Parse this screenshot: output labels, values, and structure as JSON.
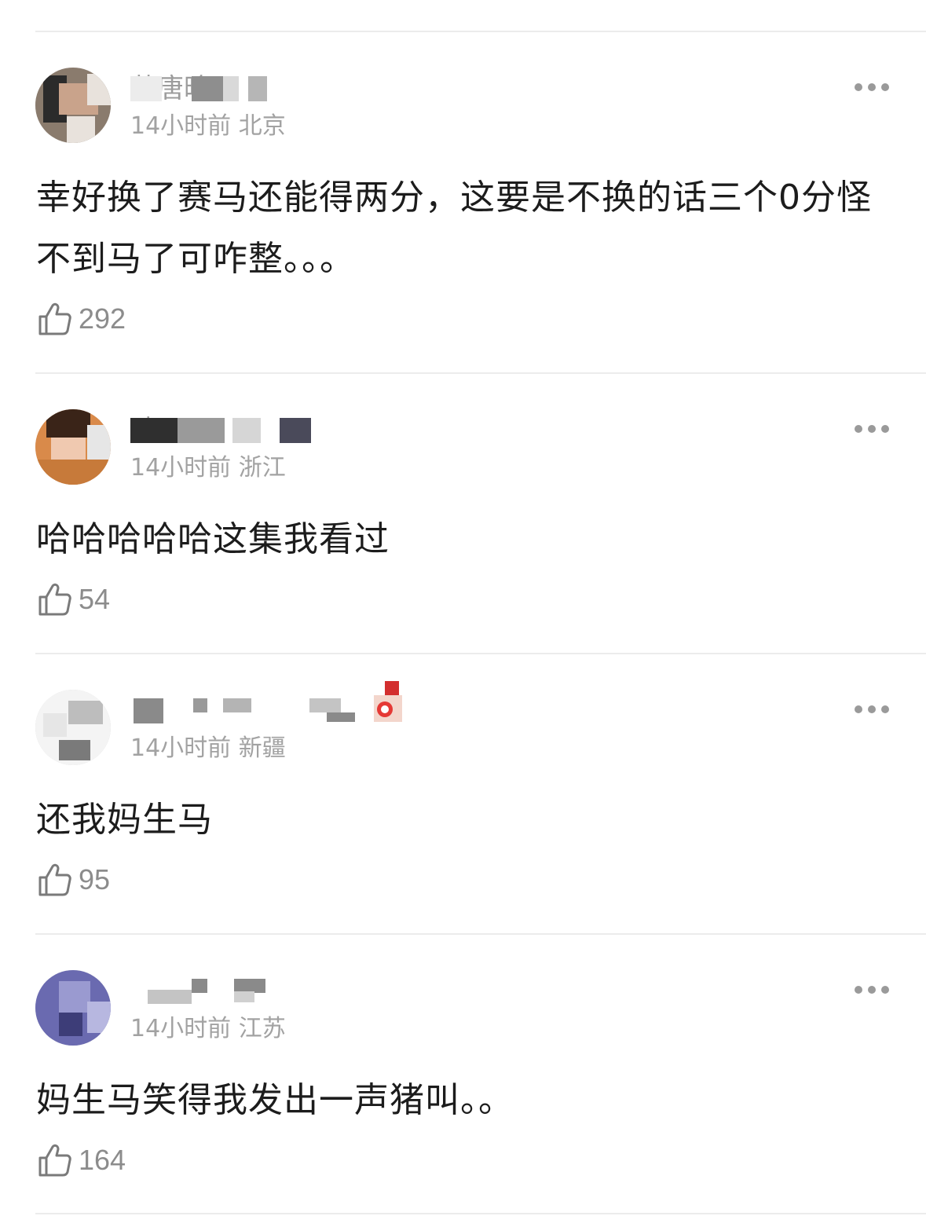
{
  "comments": [
    {
      "username": "萧唐晗风",
      "time": "14小时前",
      "location": "北京",
      "text": "幸好换了赛马还能得两分，这要是不换的话三个0分怪不到马了可咋整。。。",
      "likes": "292",
      "avatar_colors": [
        "#8a7b6d",
        "#2b2b2b",
        "#c9a38b",
        "#e8e2dc"
      ]
    },
    {
      "username": "晴天",
      "time": "14小时前",
      "location": "浙江",
      "text": "哈哈哈哈哈这集我看过",
      "likes": "54",
      "avatar_colors": [
        "#d98a4a",
        "#3a2418",
        "#f0c9b0",
        "#c77a3a"
      ]
    },
    {
      "username": "",
      "time": "14小时前",
      "location": "新疆",
      "text": "还我妈生马",
      "likes": "95",
      "avatar_colors": [
        "#f4f4f4",
        "#bdbdbd",
        "#7a7a7a",
        "#e6e6e6"
      ]
    },
    {
      "username": "",
      "time": "14小时前",
      "location": "江苏",
      "text": "妈生马笑得我发出一声猪叫。。",
      "likes": "164",
      "avatar_colors": [
        "#6a6ab0",
        "#3d3d78",
        "#9a9ad0",
        "#b7b7e0"
      ]
    }
  ],
  "icons": {
    "like": "thumbs-up-icon",
    "more": "more-horizontal-icon"
  }
}
